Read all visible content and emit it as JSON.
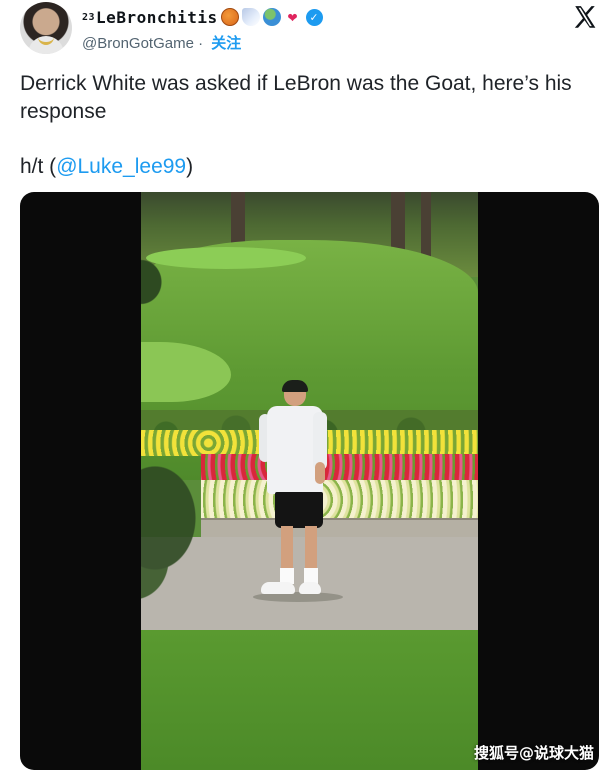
{
  "author": {
    "name_prefix": "23",
    "name": "LeBronchitis",
    "name_emojis": [
      "basketball",
      "comet",
      "globe",
      "hearts"
    ],
    "handle": "@BronGotGame",
    "separator": "·",
    "follow_label": "关注",
    "verified": true
  },
  "header": {
    "logo": "x-icon"
  },
  "tweet": {
    "text_line1": "Derrick White was asked if LeBron was the Goat, here’s his response",
    "hat_tip_prefix": "h/t (",
    "hat_tip_mention": "@Luke_lee99",
    "hat_tip_suffix": ")"
  },
  "media": {
    "type": "video",
    "description_icon": "video-frame"
  },
  "watermark": {
    "text": "搜狐号@说球大猫"
  },
  "colors": {
    "accent": "#1d9bf0",
    "text": "#0f1419",
    "secondary_text": "#536471"
  }
}
